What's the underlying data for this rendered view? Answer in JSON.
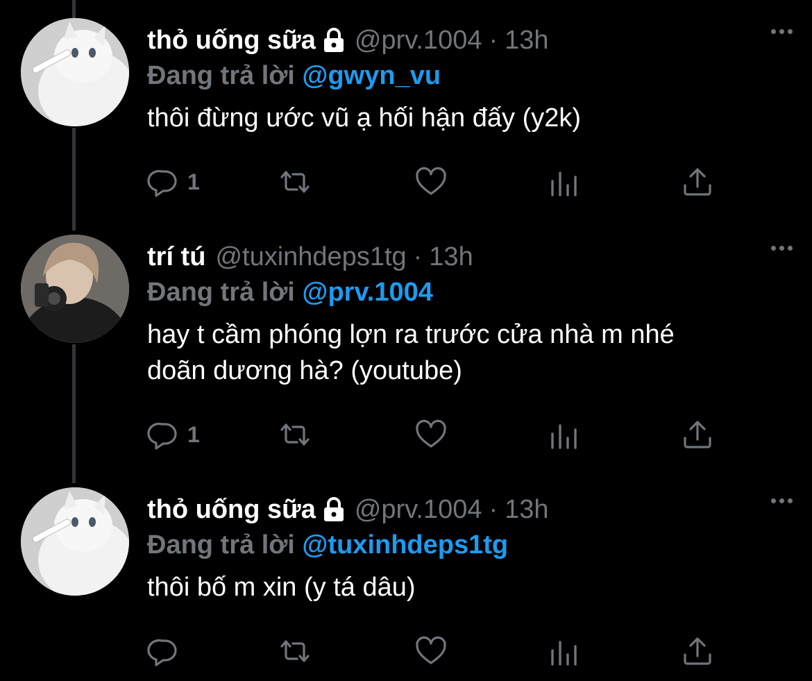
{
  "tweets": [
    {
      "name": "thỏ uống sữa",
      "locked": true,
      "handle": "@prv.1004",
      "dot": "·",
      "time": "13h",
      "reply_prefix": "Đang trả lời",
      "reply_to": "@gwyn_vu",
      "lines": [
        "thôi đừng ước vũ ạ hối hận đấy (y2k)"
      ],
      "reply_count": "1",
      "avatar": "white-cat"
    },
    {
      "name": "trí tú",
      "locked": false,
      "handle": "@tuxinhdeps1tg",
      "dot": "·",
      "time": "13h",
      "reply_prefix": "Đang trả lời",
      "reply_to": "@prv.1004",
      "lines": [
        "hay t cầm phóng lợn ra trước cửa nhà m nhé",
        "doãn dương hà? (youtube)"
      ],
      "reply_count": "1",
      "avatar": "person-with-camera"
    },
    {
      "name": "thỏ uống sữa",
      "locked": true,
      "handle": "@prv.1004",
      "dot": "·",
      "time": "13h",
      "reply_prefix": "Đang trả lời",
      "reply_to": "@tuxinhdeps1tg",
      "lines": [
        "thôi bố m xin (y tá dâu)"
      ],
      "reply_count": "",
      "avatar": "white-cat"
    }
  ],
  "icons": {
    "reply": "reply-icon",
    "retweet": "retweet-icon",
    "like": "heart-icon",
    "views": "views-icon",
    "share": "share-icon",
    "more": "more-icon",
    "lock": "lock-icon"
  },
  "colors": {
    "background": "#000000",
    "text": "#ffffff",
    "muted": "#71767b",
    "link": "#1d9bf0",
    "thread_line": "#333639"
  }
}
